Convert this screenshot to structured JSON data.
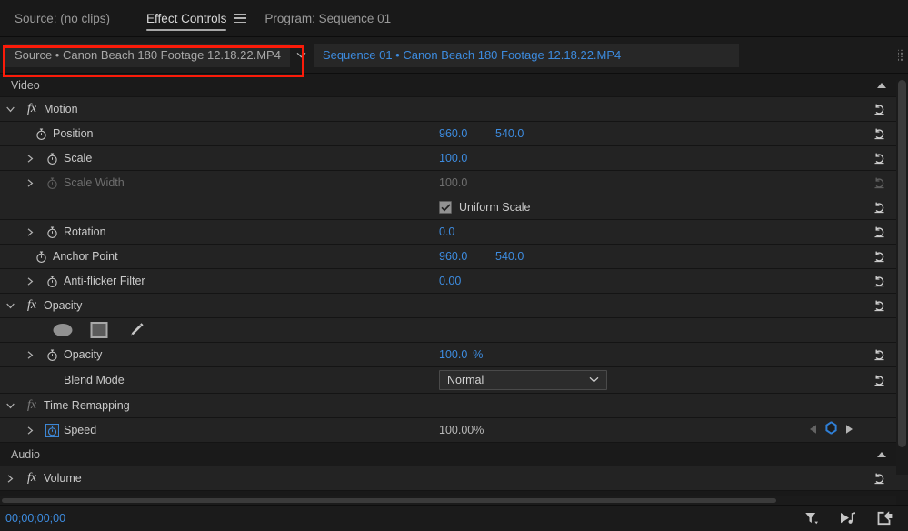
{
  "tabs": [
    {
      "label": "Source: (no clips)",
      "active": false,
      "name": "tab-source"
    },
    {
      "label": "Effect Controls",
      "active": true,
      "name": "tab-effect-controls"
    },
    {
      "label": "Program: Sequence 01",
      "active": false,
      "name": "tab-program"
    }
  ],
  "breadcrumb": {
    "source_clip": "Source • Canon Beach 180 Footage 12.18.22.MP4",
    "sequence_clip": "Sequence 01 • Canon Beach 180 Footage 12.18.22.MP4",
    "chevron": "⌄",
    "highlight_color": "#fb1b09"
  },
  "colors": {
    "value_blue": "#3d8ce0",
    "panel_bg": "#232323",
    "header_bg": "#1a1a1a",
    "text": "#c9c9c9",
    "text_dim": "#6e6e6e"
  },
  "sections": {
    "video_header": "Video",
    "audio_header": "Audio"
  },
  "effects": {
    "motion": {
      "name": "Motion",
      "properties": {
        "position": {
          "label": "Position",
          "x": "960.0",
          "y": "540.0"
        },
        "scale": {
          "label": "Scale",
          "value": "100.0"
        },
        "scale_width": {
          "label": "Scale Width",
          "value": "100.0"
        },
        "uniform_scale": {
          "label": "Uniform Scale",
          "checked": true
        },
        "rotation": {
          "label": "Rotation",
          "value": "0.0"
        },
        "anchor_point": {
          "label": "Anchor Point",
          "x": "960.0",
          "y": "540.0"
        },
        "anti_flicker": {
          "label": "Anti-flicker Filter",
          "value": "0.00"
        }
      }
    },
    "opacity": {
      "name": "Opacity",
      "mask_tools": [
        {
          "label": "ellipse-mask-tool",
          "name": "ellipse-mask-icon"
        },
        {
          "label": "rectangle-mask-tool",
          "name": "rectangle-mask-icon"
        },
        {
          "label": "pen-mask-tool",
          "name": "pen-mask-icon"
        }
      ],
      "properties": {
        "opacity": {
          "label": "Opacity",
          "value": "100.0",
          "unit": "%"
        },
        "blend_mode": {
          "label": "Blend Mode",
          "value": "Normal"
        }
      }
    },
    "time_remapping": {
      "name": "Time Remapping",
      "properties": {
        "speed": {
          "label": "Speed",
          "value": "100.00%"
        }
      }
    },
    "volume": {
      "name": "Volume"
    }
  },
  "bottom": {
    "timecode": "00;00;00;00",
    "tools": [
      {
        "name": "filter-effects-icon",
        "label": "filter"
      },
      {
        "name": "play-audio-icon",
        "label": "play-audio"
      },
      {
        "name": "export-frame-icon",
        "label": "export"
      }
    ]
  }
}
